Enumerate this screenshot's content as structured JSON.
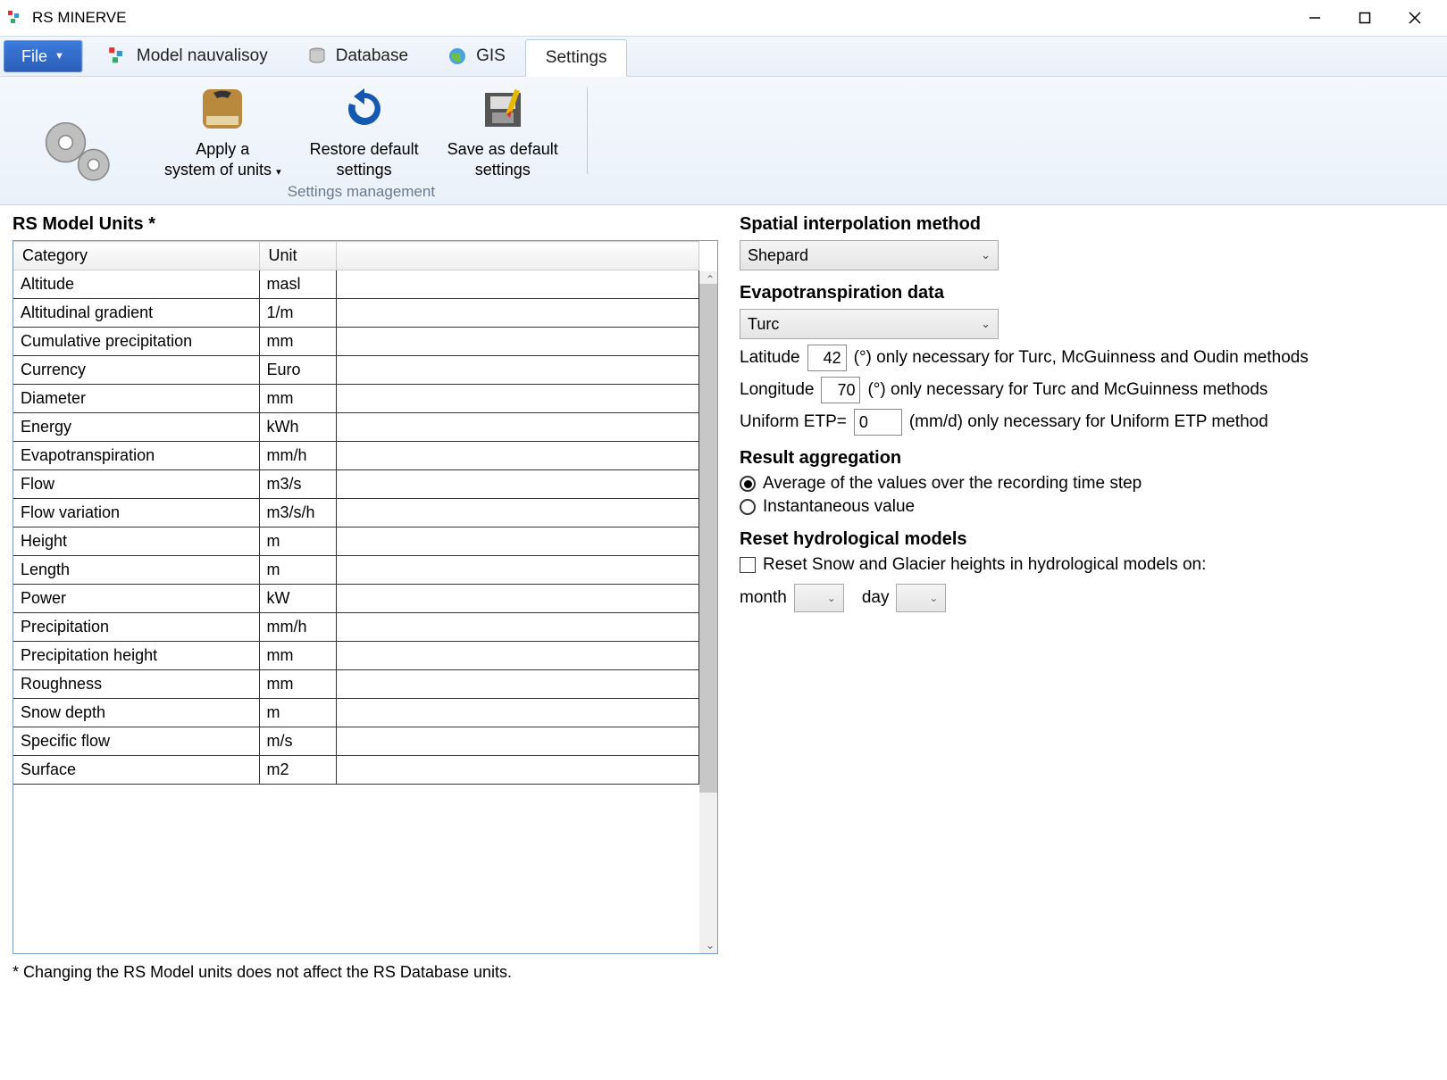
{
  "window": {
    "title": "RS MINERVE"
  },
  "file_button": "File",
  "tabs": [
    {
      "label": "Model nauvalisoy"
    },
    {
      "label": "Database"
    },
    {
      "label": "GIS"
    },
    {
      "label": "Settings"
    }
  ],
  "ribbon": {
    "apply_l1": "Apply a",
    "apply_l2": "system of units",
    "restore_l1": "Restore default",
    "restore_l2": "settings",
    "save_l1": "Save as default",
    "save_l2": "settings",
    "group_label": "Settings management"
  },
  "units": {
    "title": "RS Model Units *",
    "col_category": "Category",
    "col_unit": "Unit",
    "rows": [
      {
        "cat": "Altitude",
        "unit": "masl"
      },
      {
        "cat": "Altitudinal gradient",
        "unit": "1/m"
      },
      {
        "cat": "Cumulative precipitation",
        "unit": "mm"
      },
      {
        "cat": "Currency",
        "unit": "Euro"
      },
      {
        "cat": "Diameter",
        "unit": "mm"
      },
      {
        "cat": "Energy",
        "unit": "kWh"
      },
      {
        "cat": "Evapotranspiration",
        "unit": "mm/h"
      },
      {
        "cat": "Flow",
        "unit": "m3/s"
      },
      {
        "cat": "Flow variation",
        "unit": "m3/s/h"
      },
      {
        "cat": "Height",
        "unit": "m"
      },
      {
        "cat": "Length",
        "unit": "m"
      },
      {
        "cat": "Power",
        "unit": "kW"
      },
      {
        "cat": "Precipitation",
        "unit": "mm/h"
      },
      {
        "cat": "Precipitation height",
        "unit": "mm"
      },
      {
        "cat": "Roughness",
        "unit": "mm"
      },
      {
        "cat": "Snow depth",
        "unit": "m"
      },
      {
        "cat": "Specific flow",
        "unit": "m/s"
      },
      {
        "cat": "Surface",
        "unit": "m2"
      }
    ],
    "footnote": "* Changing the RS Model units does not affect the RS Database units."
  },
  "right": {
    "spatial_title": "Spatial interpolation method",
    "spatial_value": "Shepard",
    "evap_title": "Evapotranspiration data",
    "evap_value": "Turc",
    "lat_label": "Latitude",
    "lat_value": "42",
    "lat_hint": "(°) only necessary for Turc, McGuinness and Oudin methods",
    "lon_label": "Longitude",
    "lon_value": "70",
    "lon_hint": "(°) only necessary for Turc and McGuinness methods",
    "etp_label": "Uniform ETP=",
    "etp_value": "0",
    "etp_hint": "(mm/d) only necessary for Uniform ETP method",
    "agg_title": "Result aggregation",
    "agg_opt1": "Average of the values over the recording time step",
    "agg_opt2": "Instantaneous value",
    "reset_title": "Reset hydrological models",
    "reset_check": "Reset Snow and Glacier heights in hydrological models on:",
    "month_label": "month",
    "day_label": "day"
  }
}
